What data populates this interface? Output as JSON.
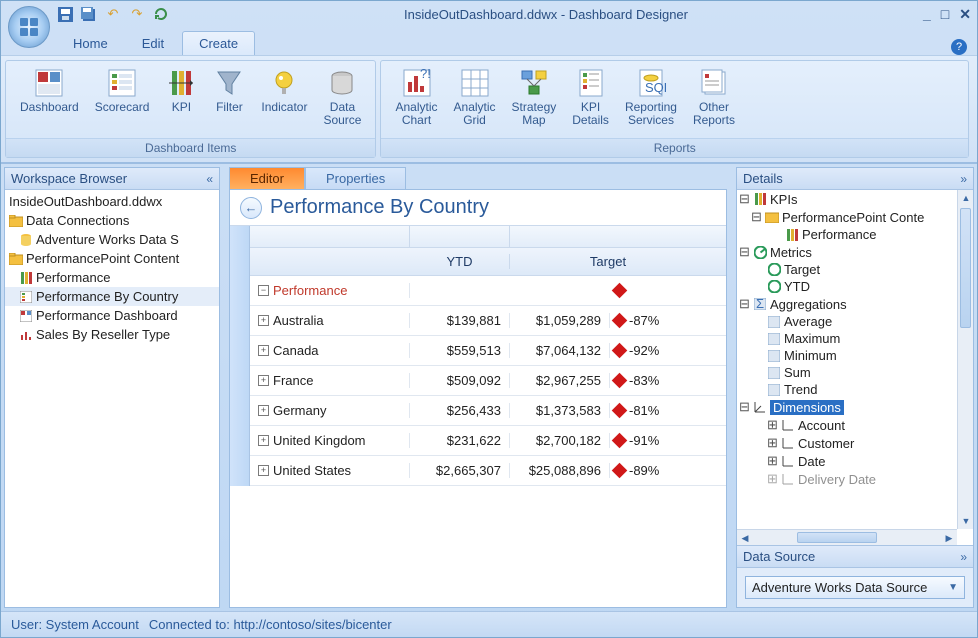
{
  "window": {
    "title": "InsideOutDashboard.ddwx - Dashboard Designer"
  },
  "tabs": {
    "home": "Home",
    "edit": "Edit",
    "create": "Create"
  },
  "ribbon": {
    "group1_label": "Dashboard Items",
    "group2_label": "Reports",
    "dashboard": "Dashboard",
    "scorecard": "Scorecard",
    "kpi": "KPI",
    "filter": "Filter",
    "indicator": "Indicator",
    "data_source": "Data\nSource",
    "analytic_chart": "Analytic\nChart",
    "analytic_grid": "Analytic\nGrid",
    "strategy_map": "Strategy\nMap",
    "kpi_details": "KPI\nDetails",
    "reporting_services": "Reporting\nServices",
    "other_reports": "Other\nReports"
  },
  "workspace": {
    "title": "Workspace Browser",
    "file": "InsideOutDashboard.ddwx",
    "data_connections": "Data Connections",
    "adventure_works": "Adventure Works Data S",
    "pp_content": "PerformancePoint Content",
    "performance": "Performance",
    "perf_by_country": "Performance By Country",
    "perf_dashboard": "Performance Dashboard",
    "sales_by_reseller": "Sales By Reseller Type"
  },
  "center": {
    "tab_editor": "Editor",
    "tab_properties": "Properties",
    "heading": "Performance By Country",
    "col_ytd": "YTD",
    "col_target": "Target",
    "perf_row": "Performance",
    "rows": [
      {
        "name": "Australia",
        "ytd": "$139,881",
        "target": "$1,059,289",
        "pct": "-87%"
      },
      {
        "name": "Canada",
        "ytd": "$559,513",
        "target": "$7,064,132",
        "pct": "-92%"
      },
      {
        "name": "France",
        "ytd": "$509,092",
        "target": "$2,967,255",
        "pct": "-83%"
      },
      {
        "name": "Germany",
        "ytd": "$256,433",
        "target": "$1,373,583",
        "pct": "-81%"
      },
      {
        "name": "United Kingdom",
        "ytd": "$231,622",
        "target": "$2,700,182",
        "pct": "-91%"
      },
      {
        "name": "United States",
        "ytd": "$2,665,307",
        "target": "$25,088,896",
        "pct": "-89%"
      }
    ]
  },
  "details": {
    "title": "Details",
    "kpis": "KPIs",
    "pp_content": "PerformancePoint Conte",
    "performance": "Performance",
    "metrics": "Metrics",
    "target": "Target",
    "ytd": "YTD",
    "aggregations": "Aggregations",
    "average": "Average",
    "maximum": "Maximum",
    "minimum": "Minimum",
    "sum": "Sum",
    "trend": "Trend",
    "dimensions": "Dimensions",
    "account": "Account",
    "customer": "Customer",
    "date": "Date",
    "delivery_date": "Delivery Date",
    "data_source_header": "Data Source",
    "data_source_value": "Adventure Works Data Source"
  },
  "status": {
    "user": "User: System Account",
    "connected": "Connected to: http://contoso/sites/bicenter"
  }
}
